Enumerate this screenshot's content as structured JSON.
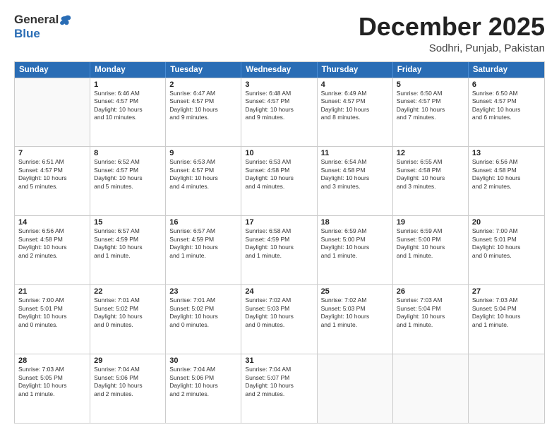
{
  "header": {
    "logo_general": "General",
    "logo_blue": "Blue",
    "title": "December 2025",
    "subtitle": "Sodhri, Punjab, Pakistan"
  },
  "days_of_week": [
    "Sunday",
    "Monday",
    "Tuesday",
    "Wednesday",
    "Thursday",
    "Friday",
    "Saturday"
  ],
  "weeks": [
    [
      {
        "day": "",
        "info": ""
      },
      {
        "day": "1",
        "info": "Sunrise: 6:46 AM\nSunset: 4:57 PM\nDaylight: 10 hours\nand 10 minutes."
      },
      {
        "day": "2",
        "info": "Sunrise: 6:47 AM\nSunset: 4:57 PM\nDaylight: 10 hours\nand 9 minutes."
      },
      {
        "day": "3",
        "info": "Sunrise: 6:48 AM\nSunset: 4:57 PM\nDaylight: 10 hours\nand 9 minutes."
      },
      {
        "day": "4",
        "info": "Sunrise: 6:49 AM\nSunset: 4:57 PM\nDaylight: 10 hours\nand 8 minutes."
      },
      {
        "day": "5",
        "info": "Sunrise: 6:50 AM\nSunset: 4:57 PM\nDaylight: 10 hours\nand 7 minutes."
      },
      {
        "day": "6",
        "info": "Sunrise: 6:50 AM\nSunset: 4:57 PM\nDaylight: 10 hours\nand 6 minutes."
      }
    ],
    [
      {
        "day": "7",
        "info": "Sunrise: 6:51 AM\nSunset: 4:57 PM\nDaylight: 10 hours\nand 5 minutes."
      },
      {
        "day": "8",
        "info": "Sunrise: 6:52 AM\nSunset: 4:57 PM\nDaylight: 10 hours\nand 5 minutes."
      },
      {
        "day": "9",
        "info": "Sunrise: 6:53 AM\nSunset: 4:57 PM\nDaylight: 10 hours\nand 4 minutes."
      },
      {
        "day": "10",
        "info": "Sunrise: 6:53 AM\nSunset: 4:58 PM\nDaylight: 10 hours\nand 4 minutes."
      },
      {
        "day": "11",
        "info": "Sunrise: 6:54 AM\nSunset: 4:58 PM\nDaylight: 10 hours\nand 3 minutes."
      },
      {
        "day": "12",
        "info": "Sunrise: 6:55 AM\nSunset: 4:58 PM\nDaylight: 10 hours\nand 3 minutes."
      },
      {
        "day": "13",
        "info": "Sunrise: 6:56 AM\nSunset: 4:58 PM\nDaylight: 10 hours\nand 2 minutes."
      }
    ],
    [
      {
        "day": "14",
        "info": "Sunrise: 6:56 AM\nSunset: 4:58 PM\nDaylight: 10 hours\nand 2 minutes."
      },
      {
        "day": "15",
        "info": "Sunrise: 6:57 AM\nSunset: 4:59 PM\nDaylight: 10 hours\nand 1 minute."
      },
      {
        "day": "16",
        "info": "Sunrise: 6:57 AM\nSunset: 4:59 PM\nDaylight: 10 hours\nand 1 minute."
      },
      {
        "day": "17",
        "info": "Sunrise: 6:58 AM\nSunset: 4:59 PM\nDaylight: 10 hours\nand 1 minute."
      },
      {
        "day": "18",
        "info": "Sunrise: 6:59 AM\nSunset: 5:00 PM\nDaylight: 10 hours\nand 1 minute."
      },
      {
        "day": "19",
        "info": "Sunrise: 6:59 AM\nSunset: 5:00 PM\nDaylight: 10 hours\nand 1 minute."
      },
      {
        "day": "20",
        "info": "Sunrise: 7:00 AM\nSunset: 5:01 PM\nDaylight: 10 hours\nand 0 minutes."
      }
    ],
    [
      {
        "day": "21",
        "info": "Sunrise: 7:00 AM\nSunset: 5:01 PM\nDaylight: 10 hours\nand 0 minutes."
      },
      {
        "day": "22",
        "info": "Sunrise: 7:01 AM\nSunset: 5:02 PM\nDaylight: 10 hours\nand 0 minutes."
      },
      {
        "day": "23",
        "info": "Sunrise: 7:01 AM\nSunset: 5:02 PM\nDaylight: 10 hours\nand 0 minutes."
      },
      {
        "day": "24",
        "info": "Sunrise: 7:02 AM\nSunset: 5:03 PM\nDaylight: 10 hours\nand 0 minutes."
      },
      {
        "day": "25",
        "info": "Sunrise: 7:02 AM\nSunset: 5:03 PM\nDaylight: 10 hours\nand 1 minute."
      },
      {
        "day": "26",
        "info": "Sunrise: 7:03 AM\nSunset: 5:04 PM\nDaylight: 10 hours\nand 1 minute."
      },
      {
        "day": "27",
        "info": "Sunrise: 7:03 AM\nSunset: 5:04 PM\nDaylight: 10 hours\nand 1 minute."
      }
    ],
    [
      {
        "day": "28",
        "info": "Sunrise: 7:03 AM\nSunset: 5:05 PM\nDaylight: 10 hours\nand 1 minute."
      },
      {
        "day": "29",
        "info": "Sunrise: 7:04 AM\nSunset: 5:06 PM\nDaylight: 10 hours\nand 2 minutes."
      },
      {
        "day": "30",
        "info": "Sunrise: 7:04 AM\nSunset: 5:06 PM\nDaylight: 10 hours\nand 2 minutes."
      },
      {
        "day": "31",
        "info": "Sunrise: 7:04 AM\nSunset: 5:07 PM\nDaylight: 10 hours\nand 2 minutes."
      },
      {
        "day": "",
        "info": ""
      },
      {
        "day": "",
        "info": ""
      },
      {
        "day": "",
        "info": ""
      }
    ]
  ]
}
